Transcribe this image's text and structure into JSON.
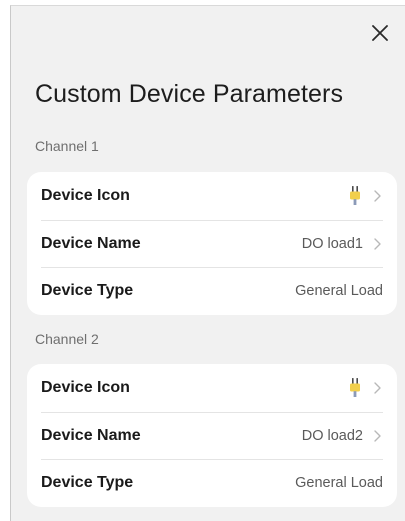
{
  "dialog": {
    "title": "Custom Device Parameters",
    "close_icon": "close-icon"
  },
  "channels": [
    {
      "label": "Channel 1",
      "rows": [
        {
          "label": "Device Icon",
          "value": "",
          "icon": "plug-icon",
          "chevron": true
        },
        {
          "label": "Device Name",
          "value": "DO load1",
          "chevron": true
        },
        {
          "label": "Device Type",
          "value": "General Load",
          "chevron": false
        }
      ]
    },
    {
      "label": "Channel 2",
      "rows": [
        {
          "label": "Device Icon",
          "value": "",
          "icon": "plug-icon",
          "chevron": true
        },
        {
          "label": "Device Name",
          "value": "DO load2",
          "chevron": true
        },
        {
          "label": "Device Type",
          "value": "General Load",
          "chevron": false
        }
      ]
    }
  ],
  "colors": {
    "background": "#f1f1f1",
    "card": "#ffffff",
    "value_text": "#5a5a5a",
    "chevron": "#b8b8b8"
  }
}
